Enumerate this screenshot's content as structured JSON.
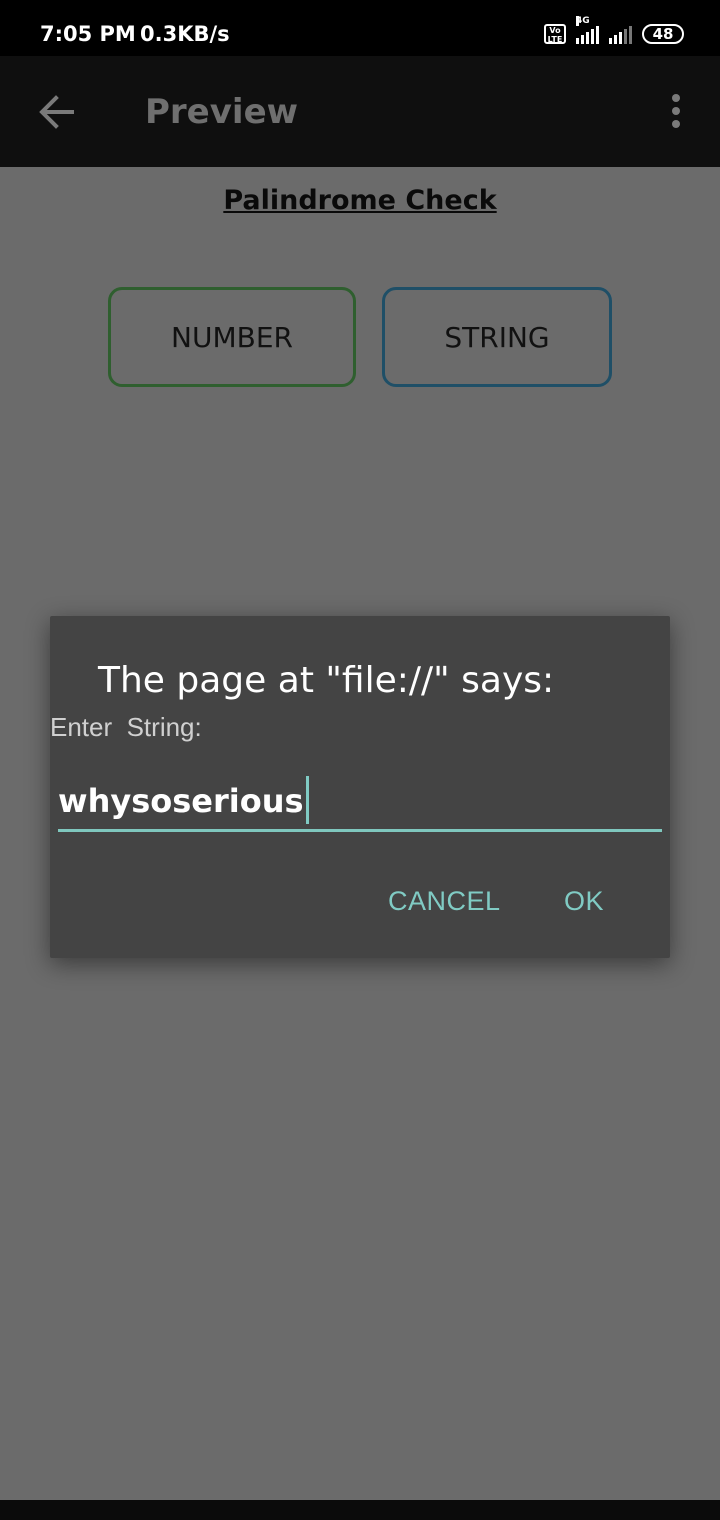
{
  "status_bar": {
    "time": "7:05 PM",
    "speed": "0.3KB/s",
    "volte_label": "Vo LTE",
    "network_label": "4G",
    "battery": "48"
  },
  "app_bar": {
    "back_icon": "arrow-left-icon",
    "title": "Preview",
    "menu_icon": "more-vert-icon"
  },
  "page": {
    "heading": "Palindrome Check",
    "buttons": [
      {
        "label": "NUMBER",
        "border_color": "#2f5f2f"
      },
      {
        "label": "STRING",
        "border_color": "#1f4f67"
      }
    ]
  },
  "dialog": {
    "title": "The page at \"file://\" says:",
    "prompt": "Enter  String:",
    "input_value": "whysoserious",
    "cancel_label": "CANCEL",
    "ok_label": "OK",
    "accent_color": "#80cbc4"
  }
}
